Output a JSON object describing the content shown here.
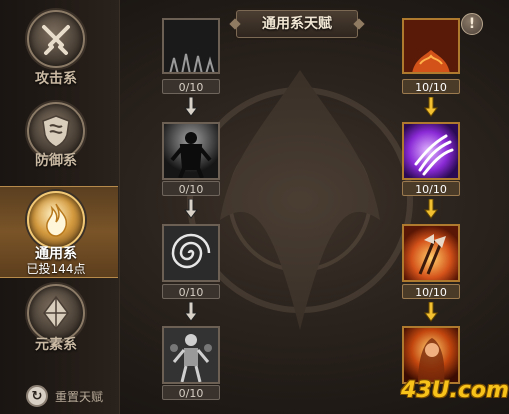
{
  "header": {
    "title": "通用系天赋"
  },
  "sidebar": {
    "categories": [
      {
        "label": "攻击系",
        "icon": "crossed-swords-icon"
      },
      {
        "label": "防御系",
        "icon": "shield-icon"
      },
      {
        "label": "通用系",
        "icon": "flame-icon",
        "sub": "已投144点",
        "selected": true
      },
      {
        "label": "元素系",
        "icon": "crystal-icon"
      }
    ],
    "reset_label": "重置天赋"
  },
  "tree": {
    "left_column": [
      {
        "icon": "dark-cave-icon",
        "points": "0/10"
      },
      {
        "icon": "shadow-figure-icon",
        "points": "0/10"
      },
      {
        "icon": "vortex-icon",
        "points": "0/10"
      },
      {
        "icon": "skeleton-warriors-icon",
        "points": "0/10"
      }
    ],
    "right_column": [
      {
        "icon": "fire-demon-icon",
        "points": "10/10"
      },
      {
        "icon": "purple-claw-icon",
        "points": "10/10"
      },
      {
        "icon": "fire-axe-icon",
        "points": "10/10"
      },
      {
        "icon": "fire-hero-icon",
        "points": ""
      }
    ]
  },
  "colors": {
    "accent_gold": "#f2c030",
    "inactive_gray": "#6c6055"
  },
  "watermark": "43U.com"
}
